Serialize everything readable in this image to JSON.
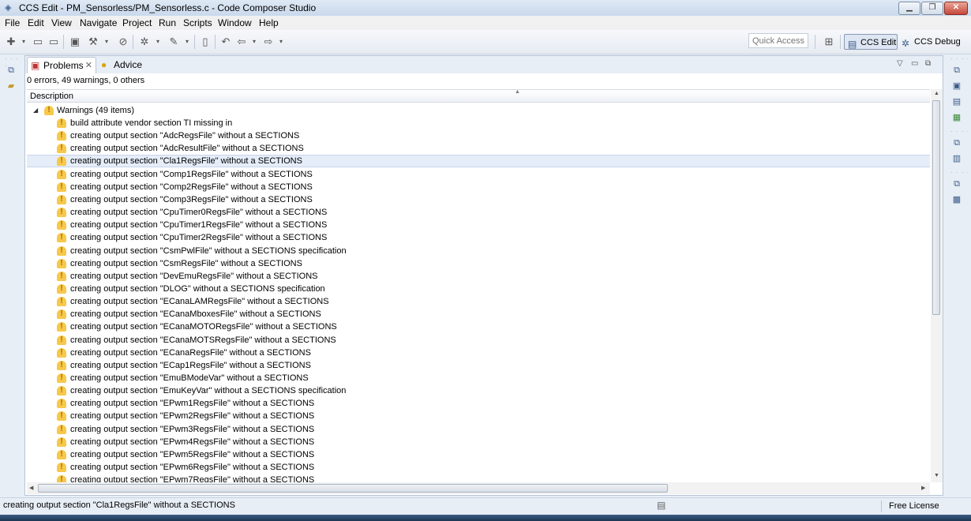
{
  "window": {
    "title": "CCS Edit - PM_Sensorless/PM_Sensorless.c - Code Composer Studio"
  },
  "menu": [
    "File",
    "Edit",
    "View",
    "Navigate",
    "Project",
    "Run",
    "Scripts",
    "Window",
    "Help"
  ],
  "toolbar": {
    "quick_access_placeholder": "Quick Access",
    "perspectives": [
      {
        "label": "CCS Edit",
        "active": true
      },
      {
        "label": "CCS Debug",
        "active": false
      }
    ]
  },
  "problems_view": {
    "tabs": [
      {
        "label": "Problems",
        "icon": "problems-icon",
        "active": true
      },
      {
        "label": "Advice",
        "icon": "lightbulb-icon",
        "active": false
      }
    ],
    "summary": "0 errors, 49 warnings, 0 others",
    "column_header": "Description",
    "group_label": "Warnings (49 items)",
    "selected_index": 3,
    "items": [
      "build attribute vendor section TI missing in",
      "creating output section \"AdcRegsFile\" without a SECTIONS",
      "creating output section \"AdcResultFile\" without a SECTIONS",
      "creating output section \"Cla1RegsFile\" without a SECTIONS",
      "creating output section \"Comp1RegsFile\" without a SECTIONS",
      "creating output section \"Comp2RegsFile\" without a SECTIONS",
      "creating output section \"Comp3RegsFile\" without a SECTIONS",
      "creating output section \"CpuTimer0RegsFile\" without a SECTIONS",
      "creating output section \"CpuTimer1RegsFile\" without a SECTIONS",
      "creating output section \"CpuTimer2RegsFile\" without a SECTIONS",
      "creating output section \"CsmPwlFile\" without a SECTIONS specification",
      "creating output section \"CsmRegsFile\" without a SECTIONS",
      "creating output section \"DevEmuRegsFile\" without a SECTIONS",
      "creating output section \"DLOG\" without a SECTIONS specification",
      "creating output section \"ECanaLAMRegsFile\" without a SECTIONS",
      "creating output section \"ECanaMboxesFile\" without a SECTIONS",
      "creating output section \"ECanaMOTORegsFile\" without a SECTIONS",
      "creating output section \"ECanaMOTSRegsFile\" without a SECTIONS",
      "creating output section \"ECanaRegsFile\" without a SECTIONS",
      "creating output section \"ECap1RegsFile\" without a SECTIONS",
      "creating output section \"EmuBModeVar\" without a SECTIONS",
      "creating output section \"EmuKeyVar\" without a SECTIONS specification",
      "creating output section \"EPwm1RegsFile\" without a SECTIONS",
      "creating output section \"EPwm2RegsFile\" without a SECTIONS",
      "creating output section \"EPwm3RegsFile\" without a SECTIONS",
      "creating output section \"EPwm4RegsFile\" without a SECTIONS",
      "creating output section \"EPwm5RegsFile\" without a SECTIONS",
      "creating output section \"EPwm6RegsFile\" without a SECTIONS",
      "creating output section \"EPwm7RegsFile\" without a SECTIONS"
    ]
  },
  "statusbar": {
    "message": "creating output section \"Cla1RegsFile\" without a SECTIONS",
    "license": "Free License"
  }
}
